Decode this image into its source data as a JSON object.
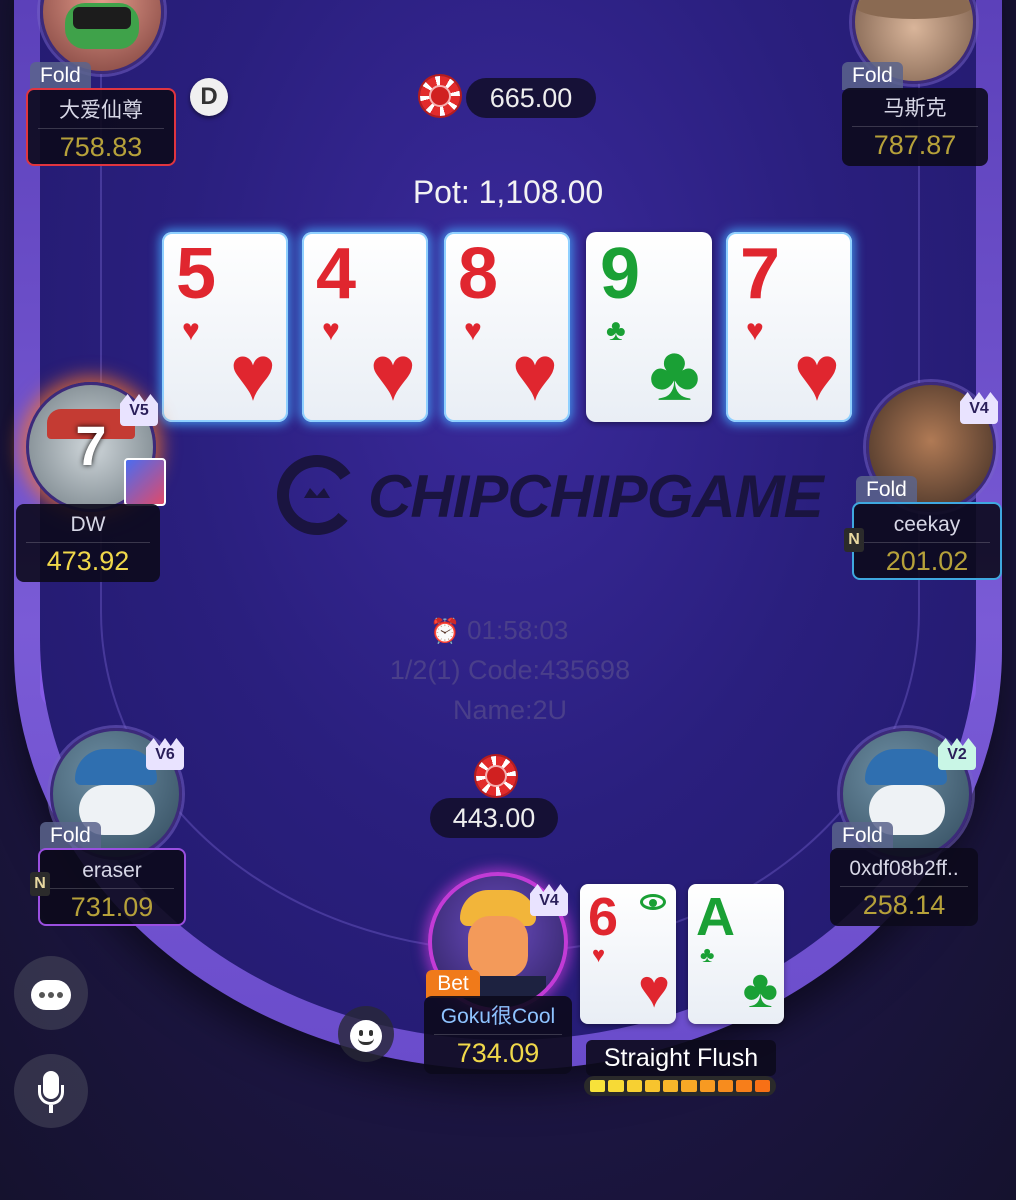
{
  "table": {
    "brand": "CHIPCHIPGAME",
    "timer": "01:58:03",
    "code_line": "1/2(1) Code:435698",
    "name_line": "Name:2U",
    "pot_label": "Pot: 1,108.00",
    "top_bet": "665.00",
    "bottom_bet": "443.00",
    "dealer_button": "D"
  },
  "board": [
    {
      "rank": "5",
      "suit": "♥",
      "color": "#e0262f"
    },
    {
      "rank": "4",
      "suit": "♥",
      "color": "#e0262f"
    },
    {
      "rank": "8",
      "suit": "♥",
      "color": "#e0262f"
    },
    {
      "rank": "9",
      "suit": "♣",
      "color": "#1aa035"
    },
    {
      "rank": "7",
      "suit": "♥",
      "color": "#e0262f"
    }
  ],
  "players": {
    "top_left": {
      "name": "大爱仙尊",
      "stack": "758.83",
      "status": "Fold"
    },
    "top_right": {
      "name": "马斯克",
      "stack": "787.87",
      "status": "Fold"
    },
    "left": {
      "name": "DW",
      "stack": "473.92",
      "level": "V5",
      "timer": "7"
    },
    "right": {
      "name": "ceekay",
      "stack": "201.02",
      "status": "Fold",
      "level": "V4",
      "badge": "N"
    },
    "bottom_left": {
      "name": "eraser",
      "stack": "731.09",
      "status": "Fold",
      "level": "V6",
      "badge": "N"
    },
    "bottom_right": {
      "name": "0xdf08b2ff..",
      "stack": "258.14",
      "status": "Fold",
      "level": "V2"
    },
    "hero": {
      "name": "Goku很Cool",
      "stack": "734.09",
      "status": "Bet",
      "level": "V4"
    }
  },
  "hero_cards": [
    {
      "rank": "6",
      "suit": "♥",
      "color": "#e0262f"
    },
    {
      "rank": "A",
      "suit": "♣",
      "color": "#1aa035"
    }
  ],
  "hand_strength": {
    "label": "Straight Flush",
    "segments_filled": 10,
    "segments_total": 10
  },
  "controls": {
    "chat_icon": "chat-icon",
    "mic_icon": "microphone-icon",
    "emoji_icon": "emoji-icon"
  }
}
